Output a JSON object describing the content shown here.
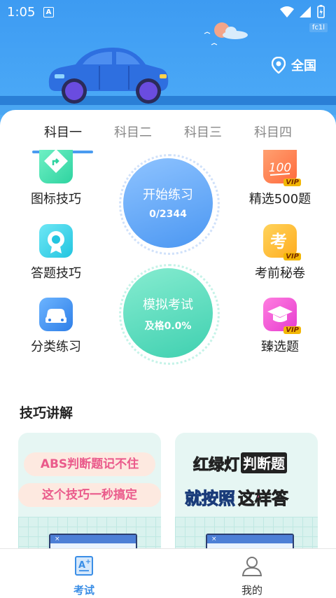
{
  "status_bar": {
    "time": "1:05",
    "notification_icon": "a-icon",
    "carrier": "fc1l"
  },
  "header": {
    "location": "全国",
    "location_icon": "location-pin-icon"
  },
  "tabs": [
    {
      "label": "科目一",
      "active": true
    },
    {
      "label": "科目二",
      "active": false
    },
    {
      "label": "科目三",
      "active": false
    },
    {
      "label": "科目四",
      "active": false
    }
  ],
  "features": {
    "left": [
      {
        "label": "图标技巧",
        "icon": "signpost-icon"
      },
      {
        "label": "答题技巧",
        "icon": "badge-icon"
      },
      {
        "label": "分类练习",
        "icon": "car-icon"
      }
    ],
    "right": [
      {
        "label": "精选500题",
        "icon": "score-100-icon",
        "vip": "VIP"
      },
      {
        "label": "考前秘卷",
        "icon": "exam-icon",
        "vip": "VIP"
      },
      {
        "label": "臻选题",
        "icon": "graduation-cap-icon",
        "vip": "VIP"
      }
    ]
  },
  "practice": {
    "title": "开始练习",
    "progress": "0/2344"
  },
  "mock_exam": {
    "title": "模拟考试",
    "pass_rate": "及格0.0%"
  },
  "tips_section": {
    "title": "技巧讲解",
    "cards": [
      {
        "line1": "ABS判断题记不住",
        "line2": "这个技巧一秒搞定"
      },
      {
        "line1a": "红绿灯",
        "line1b": "判断题",
        "line2a": "就按照",
        "line2b": "这样答"
      }
    ]
  },
  "bottom_nav": [
    {
      "label": "考试",
      "icon": "exam-paper-icon",
      "active": true
    },
    {
      "label": "我的",
      "icon": "user-icon",
      "active": false
    }
  ],
  "colors": {
    "primary": "#3d9bf2",
    "active_nav": "#3a8ee6",
    "vip": "#f2b705"
  }
}
